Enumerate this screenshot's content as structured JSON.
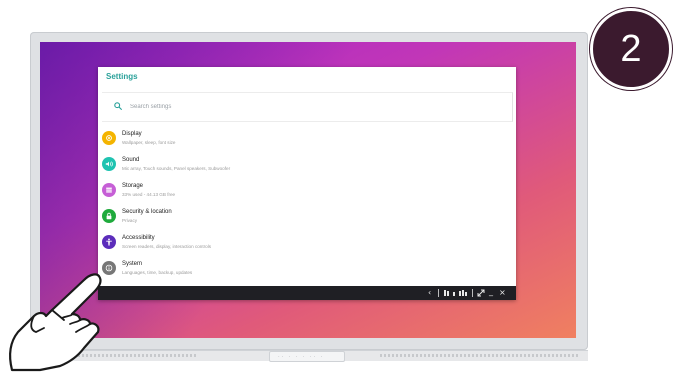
{
  "badge": {
    "number": "2"
  },
  "settings": {
    "title": "Settings",
    "search_placeholder": "Search settings",
    "items": [
      {
        "title": "Display",
        "subtitle": "Wallpaper, sleep, font size",
        "icon": "display-icon",
        "color": "#f4b400"
      },
      {
        "title": "Sound",
        "subtitle": "Mic array, Touch sounds, Panel speakers, Subwoofer",
        "icon": "sound-icon",
        "color": "#1fc3b1"
      },
      {
        "title": "Storage",
        "subtitle": "33% used - 44.13 GB free",
        "icon": "storage-icon",
        "color": "#c65fd6"
      },
      {
        "title": "Security & location",
        "subtitle": "Privacy",
        "icon": "lock-icon",
        "color": "#1faa3c"
      },
      {
        "title": "Accessibility",
        "subtitle": "Screen readers, display, interaction controls",
        "icon": "accessibility-icon",
        "color": "#5c2dbb"
      },
      {
        "title": "System",
        "subtitle": "Languages, time, backup, updates",
        "icon": "info-icon",
        "color": "#777777"
      }
    ]
  },
  "navbar": {
    "back": "‹",
    "minimize": "_",
    "close": "×"
  },
  "colors": {
    "accent": "#2aa19a",
    "badge": "#3b1a2e"
  }
}
